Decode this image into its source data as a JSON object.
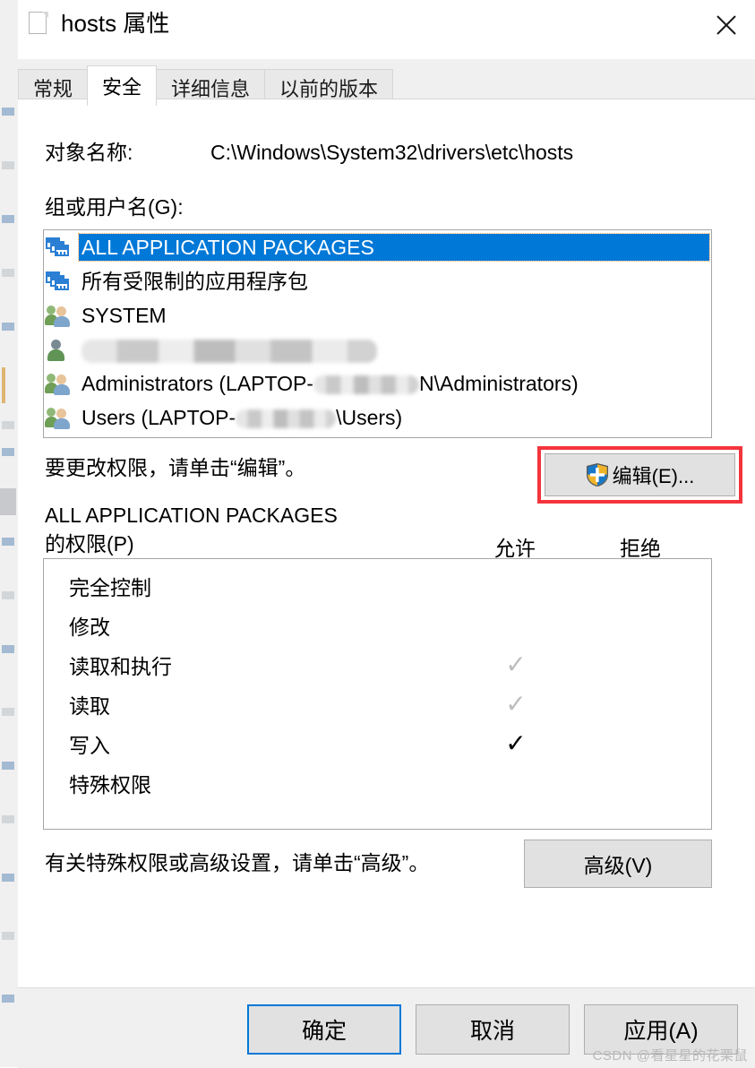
{
  "window": {
    "title": "hosts 属性",
    "doc_icon": "document-icon",
    "close_icon": "close-icon"
  },
  "tabs": [
    {
      "label": "常规",
      "active": false
    },
    {
      "label": "安全",
      "active": true
    },
    {
      "label": "详细信息",
      "active": false
    },
    {
      "label": "以前的版本",
      "active": false
    }
  ],
  "security": {
    "object_name_label": "对象名称:",
    "object_name_value": "C:\\Windows\\System32\\drivers\\etc\\hosts",
    "group_label": "组或用户名(G):",
    "principals": [
      {
        "label": "ALL APPLICATION PACKAGES",
        "icon": "app-package-icon",
        "selected": true,
        "redacted": "none"
      },
      {
        "label": "所有受限制的应用程序包",
        "icon": "app-package-icon",
        "selected": false,
        "redacted": "none"
      },
      {
        "label": "SYSTEM",
        "icon": "users-group-icon",
        "selected": false,
        "redacted": "none"
      },
      {
        "label": "",
        "icon": "user-icon",
        "selected": false,
        "redacted": "full"
      },
      {
        "label_before": "Administrators (LAPTOP-",
        "label_after": "N\\Administrators)",
        "icon": "users-group-icon",
        "selected": false,
        "redacted": "middle"
      },
      {
        "label_before": "Users (LAPTOP-",
        "label_after": "\\Users)",
        "icon": "users-group-icon",
        "selected": false,
        "redacted": "middle"
      }
    ],
    "edit_hint": "要更改权限，请单击“编辑”。",
    "edit_button": "编辑(E)...",
    "edit_button_icon": "uac-shield-icon",
    "edit_highlight_color": "#f4343c",
    "permissions_title_line1": "ALL APPLICATION PACKAGES",
    "permissions_title_line2": "的权限(P)",
    "column_allow": "允许",
    "column_deny": "拒绝",
    "permissions": [
      {
        "name": "完全控制",
        "allow": "none",
        "deny": "none"
      },
      {
        "name": "修改",
        "allow": "none",
        "deny": "none"
      },
      {
        "name": "读取和执行",
        "allow": "dim",
        "deny": "none"
      },
      {
        "name": "读取",
        "allow": "dim",
        "deny": "none"
      },
      {
        "name": "写入",
        "allow": "on",
        "deny": "none"
      },
      {
        "name": "特殊权限",
        "allow": "none",
        "deny": "none"
      }
    ],
    "check_glyph": "✓",
    "advanced_hint": "有关特殊权限或高级设置，请单击“高级”。",
    "advanced_button": "高级(V)"
  },
  "footer": {
    "ok": "确定",
    "cancel": "取消",
    "apply": "应用(A)"
  },
  "watermark": "CSDN @看星星的花栗鼠",
  "colors": {
    "selection_blue": "#0078d7",
    "highlight_red": "#f4343c",
    "dialog_bg": "#ffffff",
    "chrome_gray": "#f0f0f0",
    "button_face": "#e1e1e1"
  }
}
